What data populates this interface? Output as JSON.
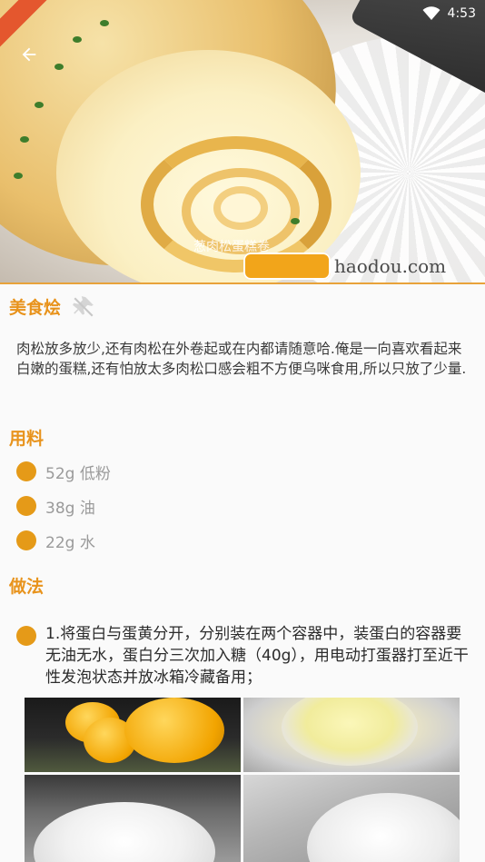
{
  "status_bar": {
    "time": "4:53"
  },
  "hero": {
    "watermark": "葱肉松蛋糕卷",
    "brand_text": "haodou.com"
  },
  "recipe": {
    "title": "美食烩",
    "description": "肉松放多放少,还有肉松在外卷起或在内都请随意哈.俺是一向喜欢看起来白嫩的蛋糕,还有怕放太多肉松口感会粗不方便乌咪食用,所以只放了少量."
  },
  "sections": {
    "ingredients_heading": "用料",
    "method_heading": "做法"
  },
  "ingredients": [
    {
      "label": "52g 低粉"
    },
    {
      "label": "38g 油"
    },
    {
      "label": "22g 水"
    }
  ],
  "steps": [
    {
      "text": "1.将蛋白与蛋黄分开，分别装在两个容器中，装蛋白的容器要无油无水，蛋白分三次加入糖（40g），用电动打蛋器打至近干性发泡状态并放冰箱冷藏备用；"
    }
  ],
  "colors": {
    "accent": "#e8931c",
    "bullet": "#e59a18",
    "ingredient_text": "#9a9a9a"
  },
  "icons": {
    "back": "arrow-left-icon",
    "favorite": "pin-off-icon",
    "wifi": "wifi-icon",
    "ingredient_bullet": "circle-bullet-icon"
  }
}
